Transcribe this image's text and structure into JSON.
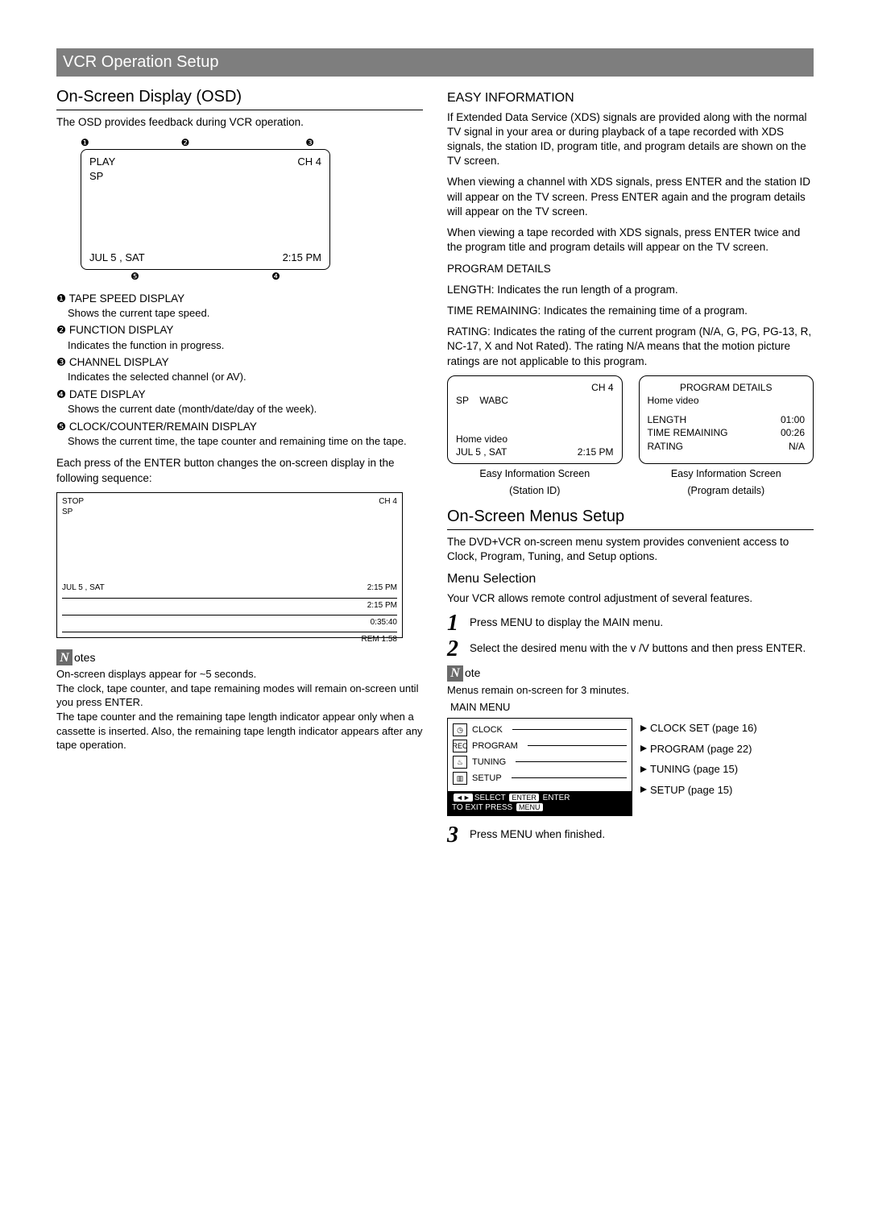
{
  "banner": "VCR Operation Setup",
  "osd": {
    "title": "On-Screen Display (OSD)",
    "intro": "The OSD provides feedback during VCR operation.",
    "callouts_top": [
      "❶",
      "❷",
      "❸"
    ],
    "box": {
      "play": "PLAY",
      "ch": "CH  4",
      "sp": "SP",
      "date": "JUL   5 , SAT",
      "time": "2:15 PM"
    },
    "callouts_bot": [
      "❺",
      "❹"
    ],
    "defs": [
      {
        "n": "❶",
        "head": "TAPE SPEED DISPLAY",
        "body": "Shows the current tape speed."
      },
      {
        "n": "❷",
        "head": "FUNCTION DISPLAY",
        "body": "Indicates the function in progress."
      },
      {
        "n": "❸",
        "head": "CHANNEL DISPLAY",
        "body": "Indicates the selected channel (or AV)."
      },
      {
        "n": "❹",
        "head": "DATE DISPLAY",
        "body": "Shows the current date (month/date/day of the week)."
      },
      {
        "n": "❺",
        "head": "CLOCK/COUNTER/REMAIN DISPLAY",
        "body": "Shows the current time, the tape counter and remaining time on the tape."
      }
    ],
    "seq_intro": "Each press of the ENTER button changes the on-screen display in the following sequence:",
    "seq": {
      "stop": "STOP",
      "sp": "SP",
      "ch": "CH  4",
      "date": "JUL   5 , SAT",
      "time1": "2:15 PM",
      "time2": "2:15 PM",
      "counter": "0:35:40",
      "rem": "REM 1:58"
    },
    "notes_label": "otes",
    "notes": "On-screen displays appear for ~5 seconds.\nThe clock, tape counter, and tape remaining modes will remain on-screen until you press ENTER.\nThe tape counter and the remaining tape length indicator appear only when a cassette is inserted. Also, the remaining tape length indicator appears after any tape operation."
  },
  "easy": {
    "title": "EASY INFORMATION",
    "p1": "If Extended Data Service (XDS) signals are provided along with the normal TV signal in your area or during playback of a tape recorded with XDS signals, the station ID, program title, and program details are shown on the TV screen.",
    "p2": "When viewing a channel with XDS signals, press ENTER and the station ID will appear on the TV screen. Press ENTER again and the program details will appear on the TV screen.",
    "p3": "When viewing a tape recorded with XDS signals, press ENTER twice and the program title and program details will appear on the TV screen.",
    "pd_head": "PROGRAM DETAILS",
    "pd_length": "LENGTH: Indicates the run length of a program.",
    "pd_time": "TIME REMAINING: Indicates the remaining time of a program.",
    "pd_rating": "RATING: Indicates the rating of the current program (N/A, G, PG, PG-13, R, NC-17, X and Not Rated). The rating N/A means that the motion picture ratings are not applicable to this program.",
    "screen1": {
      "ch": "CH  4",
      "sp": "SP",
      "station": "WABC",
      "title": "Home video",
      "date": "JUL   5 , SAT",
      "time": "2:15 PM",
      "caption1": "Easy Information Screen",
      "caption2": "(Station ID)"
    },
    "screen2": {
      "head": "PROGRAM DETAILS",
      "title": "Home video",
      "length_k": "LENGTH",
      "length_v": "01:00",
      "time_k": "TIME REMAINING",
      "time_v": "00:26",
      "rating_k": "RATING",
      "rating_v": "N/A",
      "caption1": "Easy Information Screen",
      "caption2": "(Program details)"
    }
  },
  "menus": {
    "title": "On-Screen Menus Setup",
    "intro": "The DVD+VCR on-screen menu system provides convenient access to Clock, Program, Tuning, and Setup options.",
    "sel_title": "Menu Selection",
    "sel_intro": "Your VCR allows remote control adjustment of several features.",
    "steps": [
      "Press MENU to display the MAIN menu.",
      "Select the desired menu with the    v /V  buttons and then press ENTER.",
      "Press MENU when finished."
    ],
    "note_label": "ote",
    "note": "Menus remain on-screen for 3 minutes.",
    "menu_title": "MAIN MENU",
    "items": [
      {
        "label": "CLOCK",
        "ref": "CLOCK SET (page 16)"
      },
      {
        "label": "PROGRAM",
        "ref": "PROGRAM (page 22)"
      },
      {
        "label": "TUNING",
        "ref": "TUNING (page 15)"
      },
      {
        "label": "SETUP",
        "ref": "SETUP (page 15)"
      }
    ],
    "footer_select": "SELECT",
    "footer_enter_pill": "ENTER",
    "footer_enter": "ENTER",
    "footer_exit": "TO  EXIT PRESS",
    "footer_menu_pill": "MENU"
  }
}
